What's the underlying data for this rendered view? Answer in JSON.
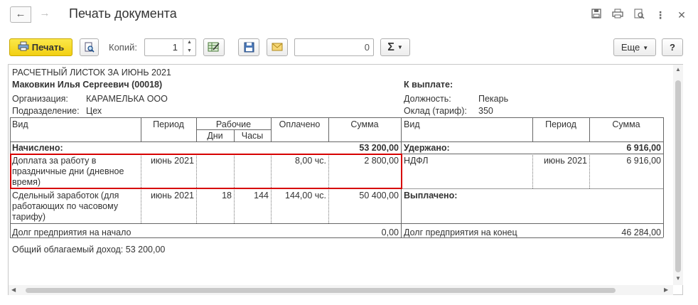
{
  "window": {
    "title": "Печать документа",
    "back_glyph": "←",
    "forward_glyph": "→"
  },
  "toolbar": {
    "print_label": "Печать",
    "copies_label": "Копий:",
    "copies_value": "1",
    "sum_value": "0",
    "sigma_label": "Σ",
    "more_label": "Еще",
    "help_label": "?"
  },
  "sheet": {
    "title": "РАСЧЕТНЫЙ ЛИСТОК ЗА ИЮНЬ 2021",
    "employee": "Маковкин Илья Сергеевич (00018)",
    "org_label": "Организация:",
    "org_value": "КАРАМЕЛЬКА ООО",
    "dept_label": "Подразделение:",
    "dept_value": "Цех",
    "pay_label": "К выплате:",
    "position_label": "Должность:",
    "position_value": "Пекарь",
    "rate_label": "Оклад (тариф):",
    "rate_value": "350",
    "headers": {
      "kind": "Вид",
      "period": "Период",
      "working": "Рабочие",
      "days": "Дни",
      "hours": "Часы",
      "paid": "Оплачено",
      "sum": "Сумма",
      "kind_right": "Вид",
      "period_right": "Период",
      "sum_right": "Сумма"
    },
    "accrued_label": "Начислено:",
    "accrued_total": "53 200,00",
    "withheld_label": "Удержано:",
    "withheld_total": "6 916,00",
    "rows_left": [
      {
        "kind": "Доплата за работу в праздничные дни (дневное время)",
        "period": "июнь 2021",
        "days": "",
        "hours": "",
        "paid": "8,00 чс.",
        "sum": "2 800,00"
      },
      {
        "kind": "Сдельный заработок (для работающих по часовому тарифу)",
        "period": "июнь 2021",
        "days": "18",
        "hours": "144",
        "paid": "144,00 чс.",
        "sum": "50 400,00"
      }
    ],
    "rows_right": [
      {
        "kind": "НДФЛ",
        "period": "июнь 2021",
        "sum": "6 916,00"
      }
    ],
    "paid_out_label": "Выплачено:",
    "debt_start_label": "Долг предприятия на начало",
    "debt_start_value": "0,00",
    "debt_end_label": "Долг предприятия на конец",
    "debt_end_value": "46 284,00",
    "taxable_income": "Общий облагаемый доход: 53 200,00"
  },
  "colors": {
    "primary_button": "#f2cf12",
    "highlight_border": "#d60000"
  }
}
